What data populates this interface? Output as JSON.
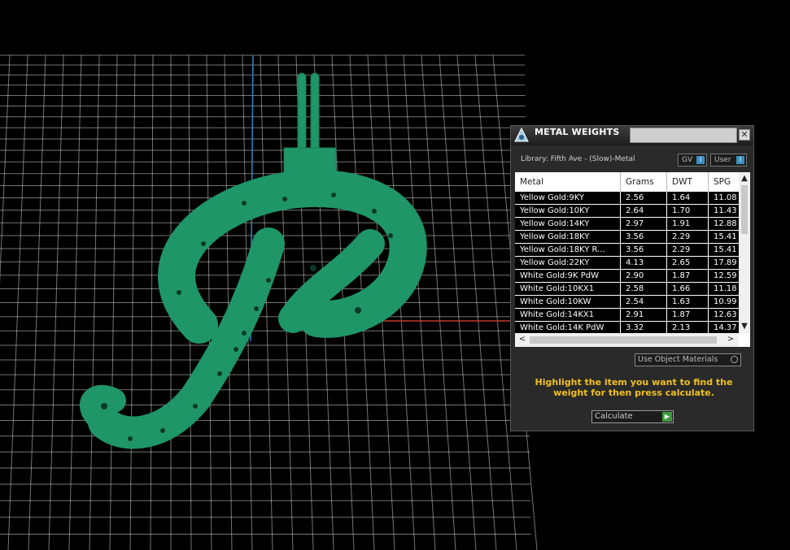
{
  "panel": {
    "title": "METAL WEIGHTS",
    "close_icon": "close-icon",
    "library_label": "Library: Fifth Ave - (Slow)-Metal",
    "toggles": [
      {
        "label": "GV",
        "indicator": "I"
      },
      {
        "label": "User",
        "indicator": "I"
      }
    ],
    "table": {
      "columns": [
        "Metal",
        "Grams",
        "DWT",
        "SPG"
      ],
      "rows": [
        [
          "Yellow Gold:9KY",
          "2.56",
          "1.64",
          "11.08"
        ],
        [
          "Yellow Gold:10KY",
          "2.64",
          "1.70",
          "11.43"
        ],
        [
          "Yellow Gold:14KY",
          "2.97",
          "1.91",
          "12.88"
        ],
        [
          "Yellow Gold:18KY",
          "3.56",
          "2.29",
          "15.41"
        ],
        [
          "Yellow Gold:18KY R...",
          "3.56",
          "2.29",
          "15.41"
        ],
        [
          "Yellow Gold:22KY",
          "4.13",
          "2.65",
          "17.89"
        ],
        [
          "White Gold:9K PdW",
          "2.90",
          "1.87",
          "12.59"
        ],
        [
          "White Gold:10KX1",
          "2.58",
          "1.66",
          "11.18"
        ],
        [
          "White Gold:10KW",
          "2.54",
          "1.63",
          "10.99"
        ],
        [
          "White Gold:14KX1",
          "2.91",
          "1.87",
          "12.63"
        ],
        [
          "White Gold:14K PdW",
          "3.32",
          "2.13",
          "14.37"
        ]
      ],
      "scroll_up": "▲",
      "scroll_down": "▼",
      "scroll_left": "<",
      "scroll_right": ">"
    },
    "use_object_materials_label": "Use Object Materials",
    "hint": "Highlight the item you want to find the weight for then press calculate.",
    "calculate_label": "Calculate",
    "calculate_icon": "play-icon"
  },
  "viewport": {
    "model_color": "#1f9668",
    "grid_color": "#ffffff",
    "x_axis_color": "#c0392b",
    "y_axis_color": "#2e86c1"
  },
  "colors": {
    "hint_text": "#f0c020",
    "indicator_blue": "#3a8fc0",
    "calculate_green": "#3e9b3e"
  }
}
